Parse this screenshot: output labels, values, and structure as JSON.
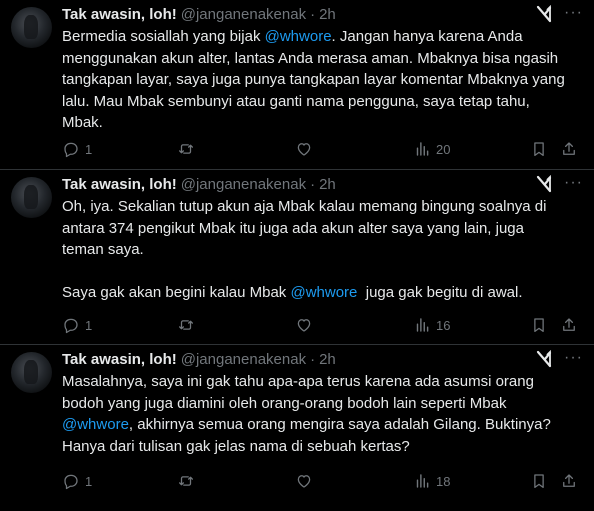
{
  "tweets": [
    {
      "name": "Tak awasin, loh!",
      "handle": "@janganenakenak",
      "sep": "·",
      "time": "2h",
      "body_1": "Bermedia sosiallah yang bijak ",
      "mention_1": "@whwore",
      "body_2": ". Jangan hanya karena Anda menggunakan akun alter, lantas Anda merasa aman. Mbaknya bisa ngasih tangkapan layar, saya juga punya tangkapan layar komentar Mbaknya yang lalu. Mau Mbak sembunyi atau ganti nama pengguna, saya tetap tahu, Mbak.",
      "replies": "1",
      "views": "20"
    },
    {
      "name": "Tak awasin, loh!",
      "handle": "@janganenakenak",
      "sep": "·",
      "time": "2h",
      "para_1": "Oh, iya. Sekalian tutup akun aja Mbak kalau memang bingung soalnya di antara 374 pengikut Mbak itu juga ada akun alter saya yang lain, juga teman saya.",
      "para_2_a": "Saya gak akan begini kalau Mbak ",
      "mention_1": "@whwore",
      "para_2_b": "  juga gak begitu di awal.",
      "replies": "1",
      "views": "16"
    },
    {
      "name": "Tak awasin, loh!",
      "handle": "@janganenakenak",
      "sep": "·",
      "time": "2h",
      "body_1": "Masalahnya, saya ini gak tahu apa-apa terus karena ada asumsi orang bodoh yang juga diamini oleh orang-orang bodoh lain seperti Mbak ",
      "mention_1": "@whwore",
      "body_2": ", akhirnya semua orang mengira saya adalah Gilang. Buktinya? Hanya dari tulisan gak jelas nama di sebuah kertas?",
      "replies": "1",
      "views": "18"
    }
  ],
  "icons": {
    "reply": "reply-icon",
    "repost": "repost-icon",
    "like": "like-icon",
    "views": "views-icon",
    "bookmark": "bookmark-icon",
    "share": "share-icon",
    "grok": "grok-icon",
    "more": "more-icon"
  },
  "colors": {
    "background": "#000000",
    "text": "#e7e9ea",
    "muted": "#71767b",
    "mention": "#1d9bf0",
    "divider": "#2f3336"
  }
}
